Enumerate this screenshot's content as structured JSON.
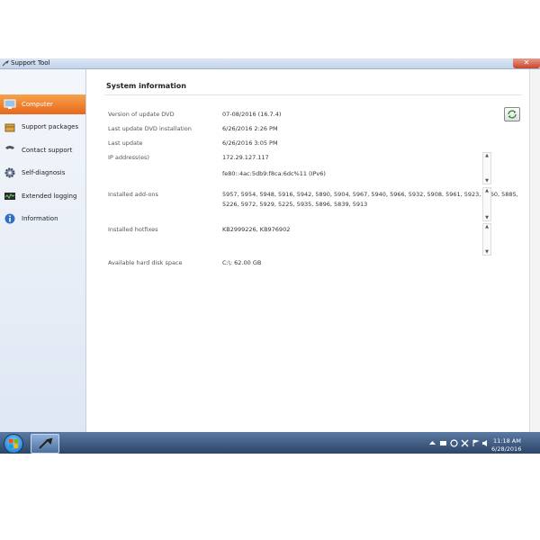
{
  "window": {
    "title": "Support Tool"
  },
  "sidebar": {
    "items": [
      {
        "label": "Computer",
        "icon": "computer-icon",
        "active": true
      },
      {
        "label": "Support packages",
        "icon": "package-icon"
      },
      {
        "label": "Contact support",
        "icon": "phone-icon"
      },
      {
        "label": "Self-diagnosis",
        "icon": "gear-icon"
      },
      {
        "label": "Extended logging",
        "icon": "log-icon"
      },
      {
        "label": "Information",
        "icon": "info-icon"
      }
    ]
  },
  "main": {
    "section_title": "System information",
    "rows": [
      {
        "label": "Version of update DVD",
        "value": "07-08/2016 (16.7.4)"
      },
      {
        "label": "Last update DVD installation",
        "value": "6/26/2016 2:26 PM"
      },
      {
        "label": "Last update",
        "value": "6/26/2016 3:05 PM"
      },
      {
        "label": "IP address(es)",
        "value": "172.29.127.117",
        "value2": "fe80::4ac:5db9:f8ca:6dc%11 (IPv6)"
      },
      {
        "label": "Installed add-ons",
        "value": "5957, 5954, 5948, 5916, 5942, 5890, 5904, 5967, 5940, 5966, 5932, 5908, 5961, 5923, 5860, 5885,",
        "value2": "5226, 5972, 5929, 5225, 5935, 5896, 5839, 5913"
      },
      {
        "label": "Installed hotfixes",
        "value": "KB2999226, KB976902"
      },
      {
        "label": "Available hard disk space",
        "value": "C:\\: 62.00 GB"
      }
    ]
  },
  "taskbar": {
    "time": "11:18 AM",
    "date": "6/28/2016"
  },
  "colors": {
    "accent": "#e8671d",
    "taskbar": "#2c4568"
  }
}
